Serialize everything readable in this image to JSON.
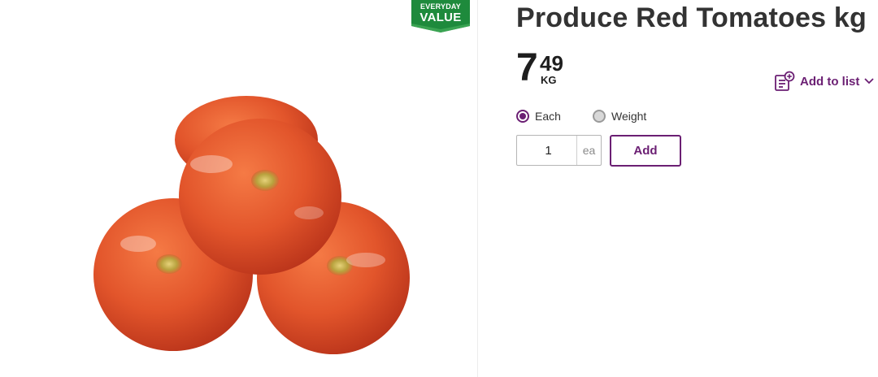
{
  "badge": {
    "line1": "EVERYDAY",
    "line2": "VALUE",
    "color": "#1e8a3c"
  },
  "product": {
    "title": "Produce Red Tomatoes kg",
    "price_dollars": "7",
    "price_cents": "49",
    "price_unit": "KG"
  },
  "actions": {
    "add_to_list_label": "Add to list",
    "add_label": "Add"
  },
  "purchase_mode": {
    "options": [
      {
        "label": "Each",
        "selected": true
      },
      {
        "label": "Weight",
        "selected": false
      }
    ]
  },
  "quantity": {
    "value": "1",
    "unit": "ea"
  },
  "colors": {
    "accent": "#6b1f73",
    "badge_green": "#1e8a3c",
    "tomato": "#e2552b"
  }
}
